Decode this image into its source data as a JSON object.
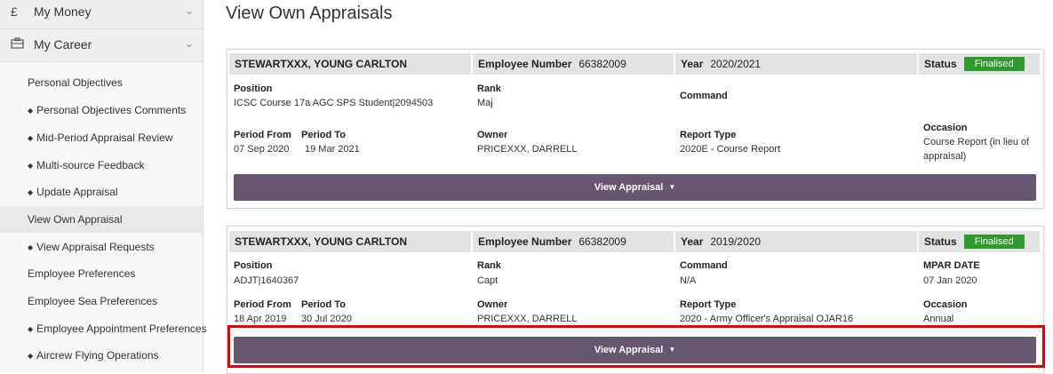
{
  "sidebar": {
    "my_money": {
      "icon": "£",
      "label": "My Money"
    },
    "my_career": {
      "icon": "briefcase-icon",
      "label": "My Career"
    },
    "items": [
      {
        "label": "Personal Objectives",
        "bullet": false
      },
      {
        "label": "Personal Objectives Comments",
        "bullet": true
      },
      {
        "label": "Mid-Period Appraisal Review",
        "bullet": true
      },
      {
        "label": "Multi-source Feedback",
        "bullet": true
      },
      {
        "label": "Update Appraisal",
        "bullet": true
      },
      {
        "label": "View Own Appraisal",
        "bullet": false,
        "active": true
      },
      {
        "label": "View Appraisal Requests",
        "bullet": true
      },
      {
        "label": "Employee Preferences",
        "bullet": false
      },
      {
        "label": "Employee Sea Preferences",
        "bullet": false
      },
      {
        "label": "Employee Appointment Preferences",
        "bullet": true
      },
      {
        "label": "Aircrew Flying Operations",
        "bullet": true
      }
    ]
  },
  "page": {
    "title": "View Own Appraisals"
  },
  "appraisals": [
    {
      "name": "STEWARTXXX, YOUNG CARLTON",
      "employee_number_label": "Employee Number",
      "employee_number": "66382009",
      "year_label": "Year",
      "year": "2020/2021",
      "status_label": "Status",
      "status": "Finalised",
      "position_label": "Position",
      "position": "ICSC Course 17a AGC SPS Student|2094503",
      "rank_label": "Rank",
      "rank": "Maj",
      "command_label": "Command",
      "command": "",
      "period_from_label": "Period From",
      "period_from": "07 Sep 2020",
      "period_to_label": "Period To",
      "period_to": "19 Mar 2021",
      "owner_label": "Owner",
      "owner": "PRICEXXX, DARRELL",
      "report_type_label": "Report Type",
      "report_type": "2020E - Course Report",
      "occasion_label": "Occasion",
      "occasion": "Course Report (in lieu of appraisal)",
      "button_label": "View Appraisal"
    },
    {
      "name": "STEWARTXXX, YOUNG CARLTON",
      "employee_number_label": "Employee Number",
      "employee_number": "66382009",
      "year_label": "Year",
      "year": "2019/2020",
      "status_label": "Status",
      "status": "Finalised",
      "position_label": "Position",
      "position": "ADJT|1640367",
      "rank_label": "Rank",
      "rank": "Capt",
      "command_label": "Command",
      "command": "N/A",
      "mpar_label": "MPAR DATE",
      "mpar_date": "07 Jan 2020",
      "period_from_label": "Period From",
      "period_from": "18 Apr 2019",
      "period_to_label": "Period To",
      "period_to": "30 Jul 2020",
      "owner_label": "Owner",
      "owner": "PRICEXXX, DARRELL",
      "report_type_label": "Report Type",
      "report_type": "2020 - Army Officer's Appraisal OJAR16",
      "occasion_label": "Occasion",
      "occasion": "Annual",
      "button_label": "View Appraisal"
    }
  ],
  "colors": {
    "status_badge": "#2e9a2e",
    "view_button": "#66566f",
    "highlight": "#e00000"
  }
}
